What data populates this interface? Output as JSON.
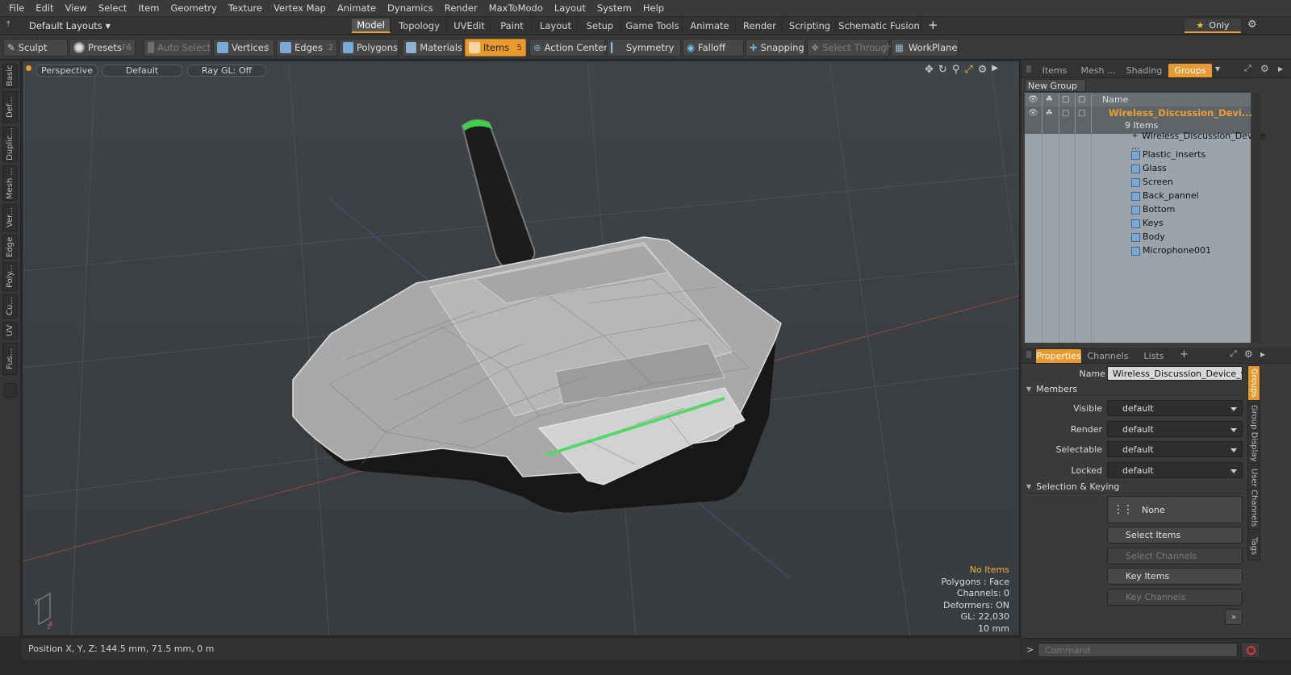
{
  "menu": [
    "File",
    "Edit",
    "View",
    "Select",
    "Item",
    "Geometry",
    "Texture",
    "Vertex Map",
    "Animate",
    "Dynamics",
    "Render",
    "MaxToModo",
    "Layout",
    "System",
    "Help"
  ],
  "layout_selector": "Default Layouts",
  "mode_tabs": [
    "Model",
    "Topology",
    "UVEdit",
    "Paint",
    "Layout",
    "Setup",
    "Game Tools",
    "Animate",
    "Render",
    "Scripting",
    "Schematic Fusion"
  ],
  "only_label": "Only",
  "toolbar": {
    "sculpt": "Sculpt",
    "presets": "Presets",
    "presets_key": "F6",
    "auto_select": "Auto Select",
    "vertices": "Vertices",
    "vertices_key": "1",
    "edges": "Edges",
    "edges_key": "2",
    "polygons": "Polygons",
    "materials": "Materials",
    "items": "Items",
    "items_key": "5",
    "action_center": "Action Center",
    "symmetry": "Symmetry",
    "falloff": "Falloff",
    "snapping": "Snapping",
    "select_through": "Select Through",
    "workplane": "WorkPlane"
  },
  "left_tabs": [
    "Basic",
    "Def...",
    "Duplic...",
    "Mesh ...",
    "Ver...",
    "Edge",
    "Poly...",
    "Cu...",
    "UV",
    "Fus..."
  ],
  "viewport": {
    "view": "Perspective",
    "shading": "Default",
    "raygl": "Ray GL: Off",
    "info": {
      "selection": "No Items",
      "polygons": "Polygons : Face",
      "channels": "Channels: 0",
      "deformers": "Deformers: ON",
      "gl": "GL: 22,030",
      "scale": "10 mm"
    }
  },
  "status": {
    "position": "Position X, Y, Z:  144.5 mm, 71.5 mm, 0 m"
  },
  "top_panel": {
    "tabs": [
      "Items",
      "Mesh ...",
      "Shading",
      "Groups"
    ],
    "active_tab": "Groups",
    "new_group": "New Group",
    "column_name": "Name",
    "group_name": "Wireless_Discussion_Devi...",
    "group_count": "9 Items",
    "children": [
      "Wireless_Discussion_Device ...",
      "Plastic_inserts",
      "Glass",
      "Screen",
      "Back_pannel",
      "Bottom",
      "Keys",
      "Body",
      "Microphone001"
    ]
  },
  "properties": {
    "tabs": [
      "Properties",
      "Channels",
      "Lists"
    ],
    "name_label": "Name",
    "name_value": "Wireless_Discussion_Device_with",
    "members_section": "Members",
    "rows": [
      {
        "label": "Visible",
        "value": "default"
      },
      {
        "label": "Render",
        "value": "default"
      },
      {
        "label": "Selectable",
        "value": "default"
      },
      {
        "label": "Locked",
        "value": "default"
      }
    ],
    "selection_section": "Selection & Keying",
    "none_label": "None",
    "select_items": "Select Items",
    "select_channels": "Select Channels",
    "key_items": "Key Items",
    "key_channels": "Key Channels",
    "side_tabs": [
      "Groups",
      "Group Display",
      "User Channels",
      "Tags"
    ]
  },
  "command": {
    "placeholder": "Command"
  }
}
